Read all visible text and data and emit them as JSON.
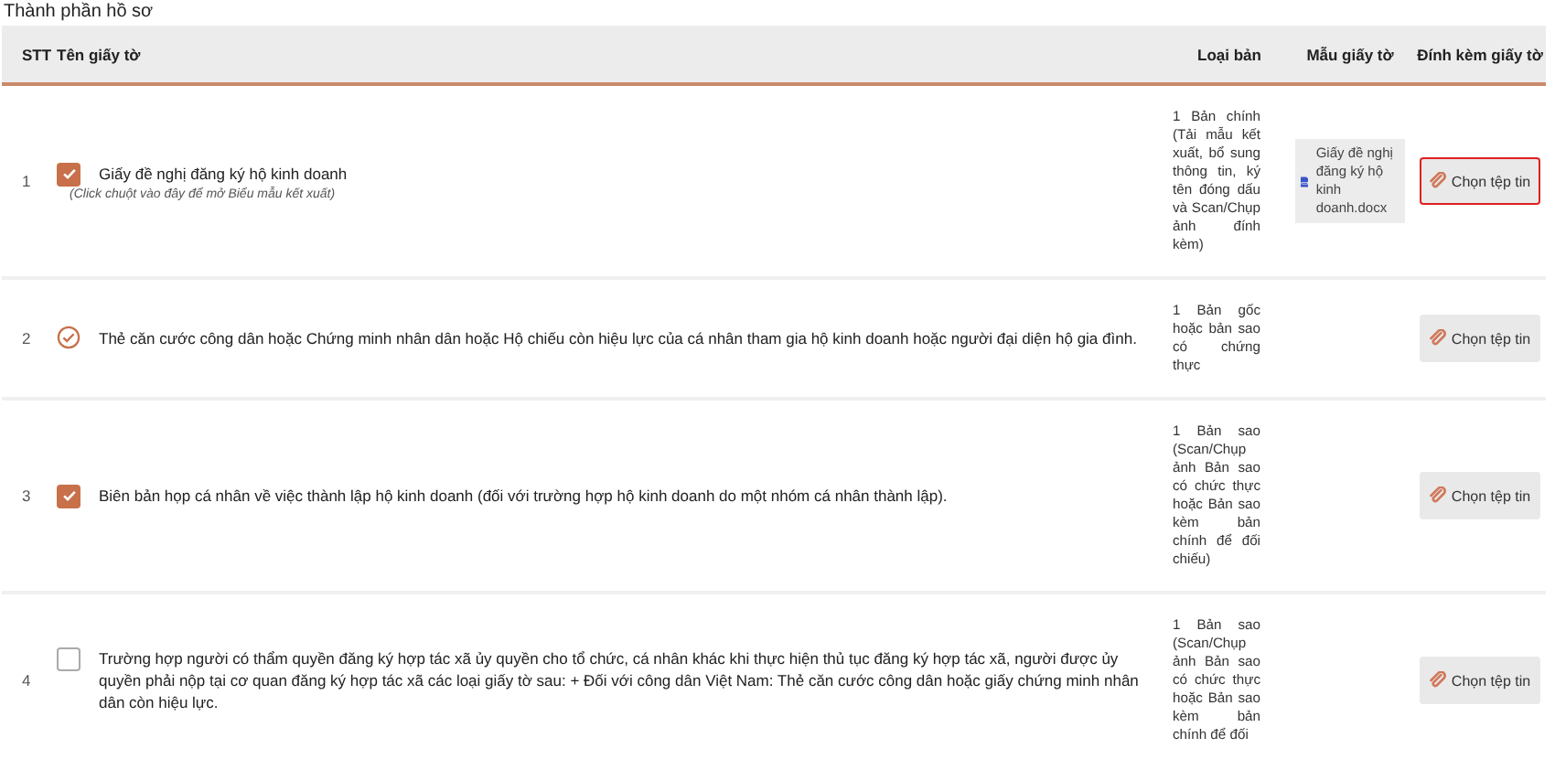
{
  "section_title": "Thành phần hồ sơ",
  "table": {
    "columns": [
      "STT",
      "Tên giấy tờ",
      "Loại bản",
      "Mẫu giấy tờ",
      "Đính kèm giấy tờ"
    ],
    "rows": [
      {
        "stt": "1",
        "kind": "checkbox",
        "checked": true,
        "name": "Giấy đề nghị đăng ký hộ kinh doanh",
        "hint": "(Click chuột vào đây để mở Biểu mẫu kết xuất)",
        "copy_type": "1 Bản chính (Tải mẫu kết xuất, bổ sung thông tin, ký tên đóng dấu và Scan/Chụp ảnh đính kèm)",
        "template": "Giấy đề nghị đăng ký hộ kinh doanh.docx",
        "button": "Chọn tệp tin",
        "highlighted": true
      },
      {
        "stt": "2",
        "kind": "done",
        "name": "Thẻ căn cước công dân hoặc Chứng minh nhân dân hoặc Hộ chiếu còn hiệu lực của cá nhân tham gia hộ kinh doanh hoặc người đại diện hộ gia đình.",
        "copy_type": "1 Bản gốc hoặc bản sao có chứng thực",
        "button": "Chọn tệp tin",
        "highlighted": false
      },
      {
        "stt": "3",
        "kind": "checkbox",
        "checked": true,
        "name": "Biên bản họp cá nhân về việc thành lập hộ kinh doanh (đối với trường hợp hộ kinh doanh do một nhóm cá nhân thành lập).",
        "copy_type": "1 Bản sao (Scan/Chụp ảnh Bản sao có chức thực hoặc Bản sao kèm bản chính để đối chiếu)",
        "button": "Chọn tệp tin",
        "highlighted": false
      },
      {
        "stt": "4",
        "kind": "checkbox",
        "checked": false,
        "name": "Trường hợp người có thẩm quyền đăng ký hợp tác xã ủy quyền cho tổ chức, cá nhân khác khi thực hiện thủ tục đăng ký hợp tác xã, người được ủy quyền phải nộp tại cơ quan đăng ký hợp tác xã các loại giấy tờ sau: + Đối với công dân Việt Nam: Thẻ căn cước công dân hoặc giấy chứng minh nhân dân còn hiệu lực.",
        "copy_type": "1 Bản sao (Scan/Chụp ảnh Bản sao có chức thực hoặc Bản sao kèm bản chính để đối",
        "button": "Chọn tệp tin",
        "highlighted": false
      }
    ]
  }
}
